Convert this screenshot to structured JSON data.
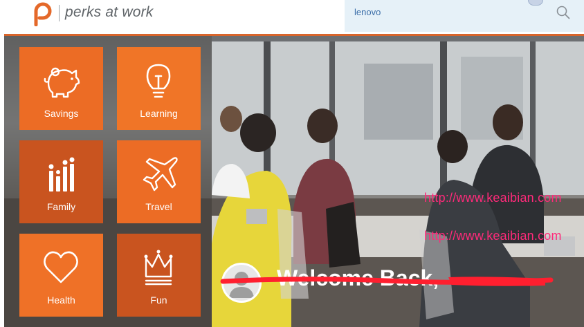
{
  "header": {
    "brand": "perks at work",
    "search": {
      "value": "lenovo",
      "placeholder": ""
    }
  },
  "tiles": [
    {
      "label": "Savings",
      "icon": "piggy-bank-icon"
    },
    {
      "label": "Learning",
      "icon": "lightbulb-icon"
    },
    {
      "label": "Family",
      "icon": "family-icon"
    },
    {
      "label": "Travel",
      "icon": "airplane-icon"
    },
    {
      "label": "Health",
      "icon": "heart-icon"
    },
    {
      "label": "Fun",
      "icon": "crown-icon"
    }
  ],
  "welcome": {
    "text": "Welcome Back, "
  },
  "watermarks": [
    "http://www.keaibian.com",
    "http://www.keaibian.com"
  ],
  "colors": {
    "brand_orange": "#ec6c25",
    "tile_dark": "#c9541f",
    "search_bg": "#e6f1f8",
    "watermark": "#ff2a7a"
  }
}
